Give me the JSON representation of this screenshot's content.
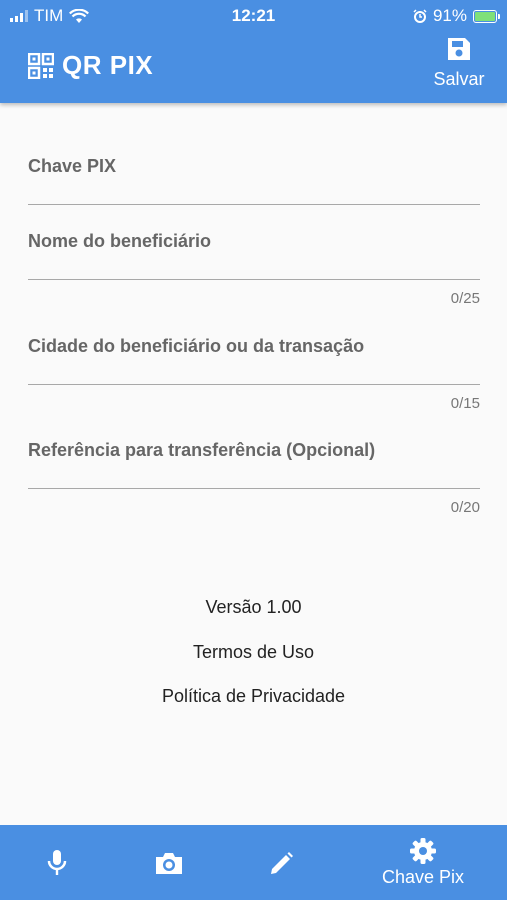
{
  "status_bar": {
    "carrier": "TIM",
    "time": "12:21",
    "battery": "91%",
    "battery_level": 0.91
  },
  "header": {
    "title": "QR PIX",
    "save_label": "Salvar"
  },
  "form": {
    "fields": [
      {
        "label": "Chave PIX",
        "counter": ""
      },
      {
        "label": "Nome do beneficiário",
        "counter": "0/25"
      },
      {
        "label": "Cidade do beneficiário ou da transação",
        "counter": "0/15"
      },
      {
        "label": "Referência para transferência (Opcional)",
        "counter": "0/20"
      }
    ]
  },
  "info": {
    "version": "Versão 1.00",
    "terms": "Termos de Uso",
    "privacy": "Política de Privacidade"
  },
  "bottom_nav": {
    "items": [
      {
        "icon": "microphone-icon",
        "label": ""
      },
      {
        "icon": "camera-icon",
        "label": ""
      },
      {
        "icon": "pencil-icon",
        "label": ""
      },
      {
        "icon": "gear-icon",
        "label": "Chave Pix"
      }
    ]
  },
  "colors": {
    "primary": "#4a8fe2",
    "background": "#fafafa"
  }
}
